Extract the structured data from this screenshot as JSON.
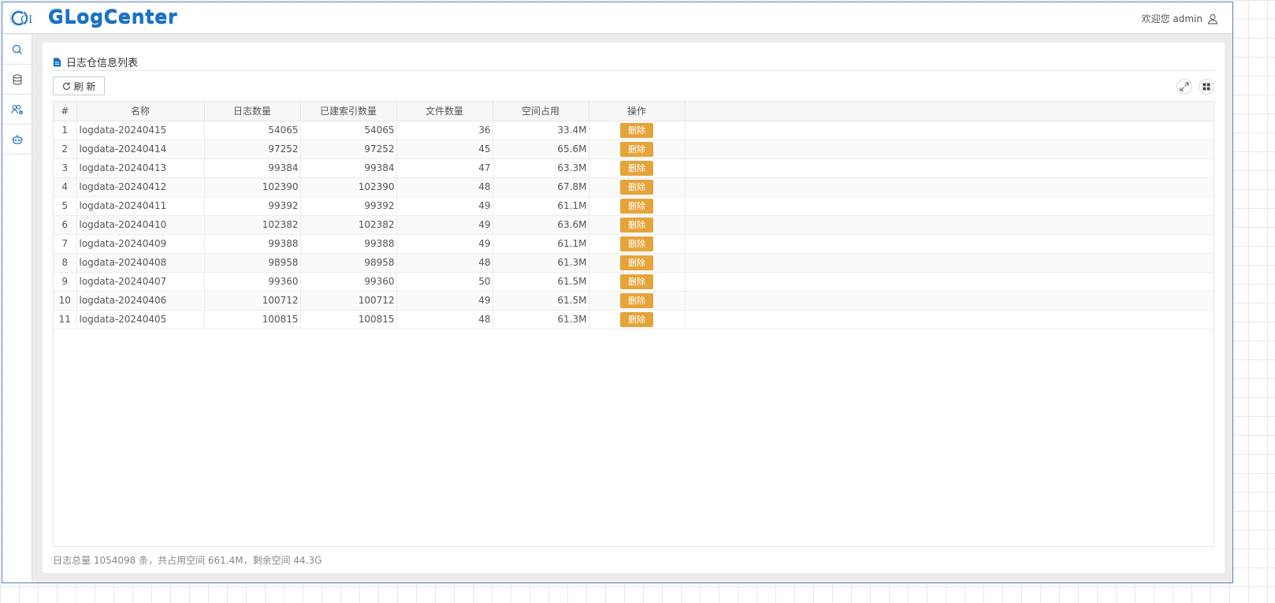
{
  "app": {
    "title": "GLogCenter",
    "logo_text": "CL"
  },
  "header": {
    "welcome_text": "欢迎您 admin",
    "user_icon": "user-icon"
  },
  "sidebar": {
    "items": [
      {
        "icon": "search-icon"
      },
      {
        "icon": "database-icon"
      },
      {
        "icon": "users-settings-icon"
      },
      {
        "icon": "robot-icon"
      }
    ]
  },
  "panel": {
    "title": "日志仓信息列表",
    "refresh_label": "刷 新"
  },
  "table": {
    "columns": [
      "#",
      "名称",
      "日志数量",
      "已建索引数量",
      "文件数量",
      "空间占用",
      "操作"
    ],
    "delete_label": "删除",
    "rows": [
      {
        "idx": "1",
        "name": "logdata-20240415",
        "logs": "54065",
        "indexed": "54065",
        "files": "36",
        "space": "33.4M"
      },
      {
        "idx": "2",
        "name": "logdata-20240414",
        "logs": "97252",
        "indexed": "97252",
        "files": "45",
        "space": "65.6M"
      },
      {
        "idx": "3",
        "name": "logdata-20240413",
        "logs": "99384",
        "indexed": "99384",
        "files": "47",
        "space": "63.3M"
      },
      {
        "idx": "4",
        "name": "logdata-20240412",
        "logs": "102390",
        "indexed": "102390",
        "files": "48",
        "space": "67.8M"
      },
      {
        "idx": "5",
        "name": "logdata-20240411",
        "logs": "99392",
        "indexed": "99392",
        "files": "49",
        "space": "61.1M"
      },
      {
        "idx": "6",
        "name": "logdata-20240410",
        "logs": "102382",
        "indexed": "102382",
        "files": "49",
        "space": "63.6M"
      },
      {
        "idx": "7",
        "name": "logdata-20240409",
        "logs": "99388",
        "indexed": "99388",
        "files": "49",
        "space": "61.1M"
      },
      {
        "idx": "8",
        "name": "logdata-20240408",
        "logs": "98958",
        "indexed": "98958",
        "files": "48",
        "space": "61.3M"
      },
      {
        "idx": "9",
        "name": "logdata-20240407",
        "logs": "99360",
        "indexed": "99360",
        "files": "50",
        "space": "61.5M"
      },
      {
        "idx": "10",
        "name": "logdata-20240406",
        "logs": "100712",
        "indexed": "100712",
        "files": "49",
        "space": "61.5M"
      },
      {
        "idx": "11",
        "name": "logdata-20240405",
        "logs": "100815",
        "indexed": "100815",
        "files": "48",
        "space": "61.3M"
      }
    ]
  },
  "footer": {
    "summary": "日志总量 1054098 条，共占用空间 661.4M，剩余空间 44.3G"
  },
  "colors": {
    "brand": "#1a73c8",
    "delete_button": "#e5a43a",
    "icon_blue": "#1a73c8"
  }
}
